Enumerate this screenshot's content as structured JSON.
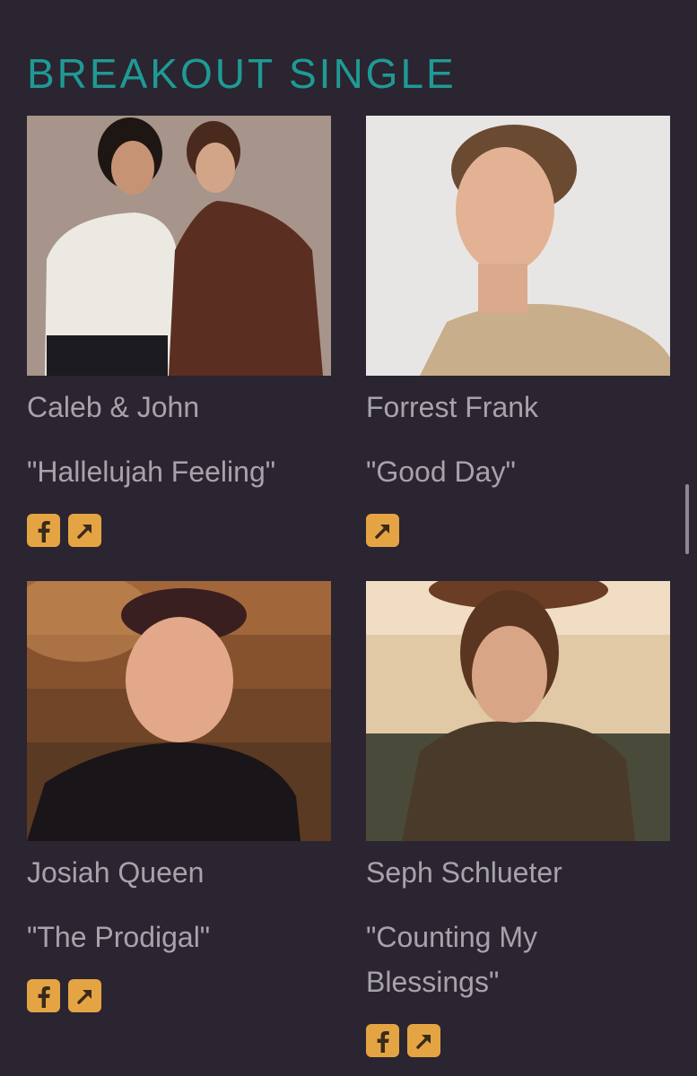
{
  "section": {
    "title": "BREAKOUT SINGLE"
  },
  "colors": {
    "background": "#2a2530",
    "accent": "#1f9a95",
    "icon_bg": "#e5a444",
    "text": "#a8a3ab"
  },
  "cards": [
    {
      "artist": "Caleb & John",
      "song": "\"Hallelujah Feeling\"",
      "icons": [
        "facebook-icon",
        "external-link-icon"
      ]
    },
    {
      "artist": "Forrest Frank",
      "song": "\"Good Day\"",
      "icons": [
        "external-link-icon"
      ]
    },
    {
      "artist": "Josiah Queen",
      "song": "\"The Prodigal\"",
      "icons": [
        "facebook-icon",
        "external-link-icon"
      ]
    },
    {
      "artist": "Seph Schlueter",
      "song": "\"Counting My Blessings\"",
      "icons": [
        "facebook-icon",
        "external-link-icon"
      ]
    }
  ]
}
